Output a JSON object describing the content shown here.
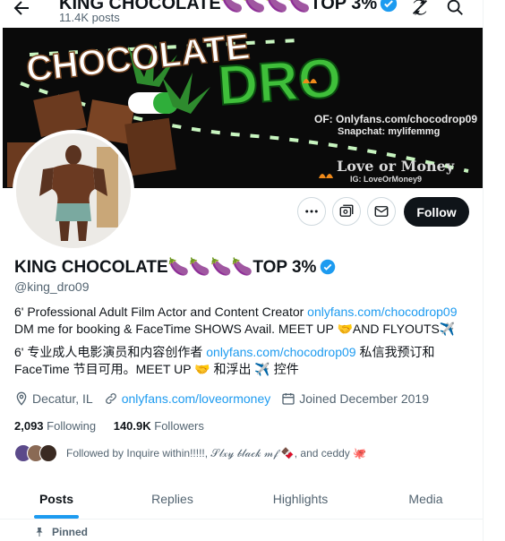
{
  "header": {
    "title": "KING CHOCOLATE🍆🍆🍆🍆TOP 3%",
    "post_count": "11.4K posts"
  },
  "banner": {
    "headline_left": "CHOCOLATE",
    "headline_right": "DRO",
    "onlyfans_text": "OF: Onlyfans.com/chocodrop09",
    "snapchat_text": "Snapchat: mylifemmg",
    "love_text": "Love or Money",
    "ig_text": "IG: LoveOrMoney9"
  },
  "actions": {
    "follow_label": "Follow"
  },
  "profile": {
    "name": "KING CHOCOLATE🍆🍆🍆🍆TOP 3%",
    "handle": "@king_dro09",
    "bio_line1_text": "6' Professional Adult Film Actor and Content Creator ",
    "bio_line1_link": "onlyfans.com/chocodrop09",
    "bio_line2": "DM me for booking & FaceTime SHOWS Avail. MEET UP 🤝AND FLYOUTS✈️",
    "bio_line3_text": "6' 专业成人电影演员和内容创作者  ",
    "bio_line3_link": "onlyfans.com/chocodrop09",
    "bio_line3_tail": " 私信我预订和",
    "bio_line4": "FaceTime 节目可用。MEET UP  🤝  和浮出  ✈️  控件",
    "location": "Decatur, IL",
    "website": "onlyfans.com/loveormoney",
    "joined": "Joined December 2019",
    "following_count": "2,093",
    "following_label": "Following",
    "followers_count": "140.9K",
    "followers_label": "Followers",
    "followed_by": "Followed by Inquire within!!!!!, 𝒮𝓁𝓍𝓎 𝒷𝓁𝒶𝒸𝓀 𝓂𝒻 🍫, and ceddy 🐙"
  },
  "tabs": {
    "posts": "Posts",
    "replies": "Replies",
    "highlights": "Highlights",
    "media": "Media"
  },
  "pinned_label": "Pinned",
  "colors": {
    "link": "#1d9bf0",
    "verified": "#1d9bf0",
    "follow_bg": "#0f1419",
    "banner_green": "#2fae3a"
  },
  "icons": [
    "back-arrow-icon",
    "no-notification-icon",
    "search-icon",
    "more-icon",
    "subscribe-icon",
    "message-icon",
    "verified-icon",
    "location-icon",
    "link-icon",
    "calendar-icon",
    "pin-icon"
  ]
}
